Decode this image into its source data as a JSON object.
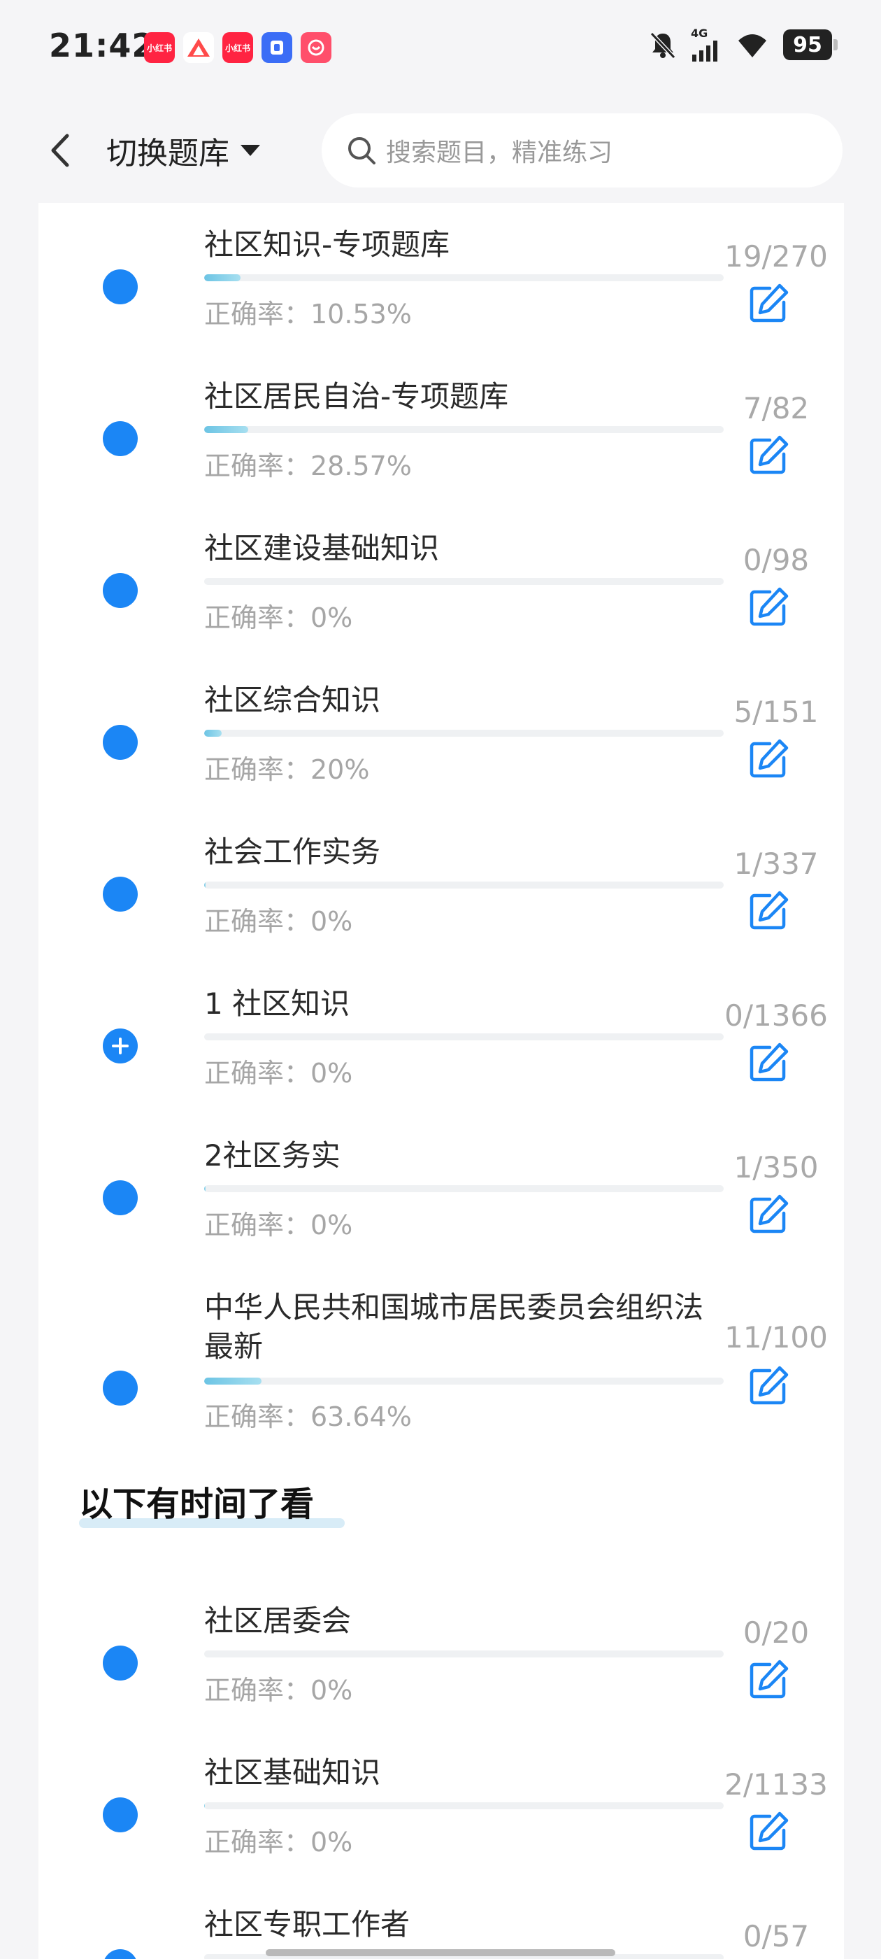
{
  "status_bar": {
    "time": "21:42",
    "battery": "95",
    "network": "4G",
    "apps": [
      {
        "name": "小红书",
        "color": "#ff2442"
      },
      {
        "name": "app-triangle",
        "color": "#ffffff"
      },
      {
        "name": "小红书",
        "color": "#ff2442"
      },
      {
        "name": "app-blue",
        "color": "#3b6df6"
      },
      {
        "name": "app-pink",
        "color": "#ff4f6b"
      }
    ]
  },
  "header": {
    "title": "切换题库",
    "search_placeholder": "搜索题目，精准练习"
  },
  "items": [
    {
      "title": "社区知识-专项题库",
      "accuracy": "正确率：10.53%",
      "count": "19/270",
      "progress": 0.07,
      "icon": "dot"
    },
    {
      "title": "社区居民自治-专项题库",
      "accuracy": "正确率：28.57%",
      "count": "7/82",
      "progress": 0.085,
      "icon": "dot"
    },
    {
      "title": "社区建设基础知识",
      "accuracy": "正确率：0%",
      "count": "0/98",
      "progress": 0,
      "icon": "dot"
    },
    {
      "title": "社区综合知识",
      "accuracy": "正确率：20%",
      "count": "5/151",
      "progress": 0.033,
      "icon": "dot"
    },
    {
      "title": "社会工作实务",
      "accuracy": "正确率：0%",
      "count": "1/337",
      "progress": 0.003,
      "icon": "dot"
    },
    {
      "title": "1 社区知识",
      "accuracy": "正确率：0%",
      "count": "0/1366",
      "progress": 0,
      "icon": "plus"
    },
    {
      "title": "2社区务实",
      "accuracy": "正确率：0%",
      "count": "1/350",
      "progress": 0.003,
      "icon": "dot"
    },
    {
      "title": "中华人民共和国城市居民委员会组织法 最新",
      "accuracy": "正确率：63.64%",
      "count": "11/100",
      "progress": 0.11,
      "icon": "dot"
    }
  ],
  "section_title": "以下有时间了看",
  "items2": [
    {
      "title": "社区居委会",
      "accuracy": "正确率：0%",
      "count": "0/20",
      "progress": 0,
      "icon": "dot"
    },
    {
      "title": "社区基础知识",
      "accuracy": "正确率：0%",
      "count": "2/1133",
      "progress": 0.002,
      "icon": "dot"
    },
    {
      "title": "社区专职工作者",
      "accuracy": "",
      "count": "0/57",
      "progress": 0,
      "icon": "dot"
    }
  ]
}
